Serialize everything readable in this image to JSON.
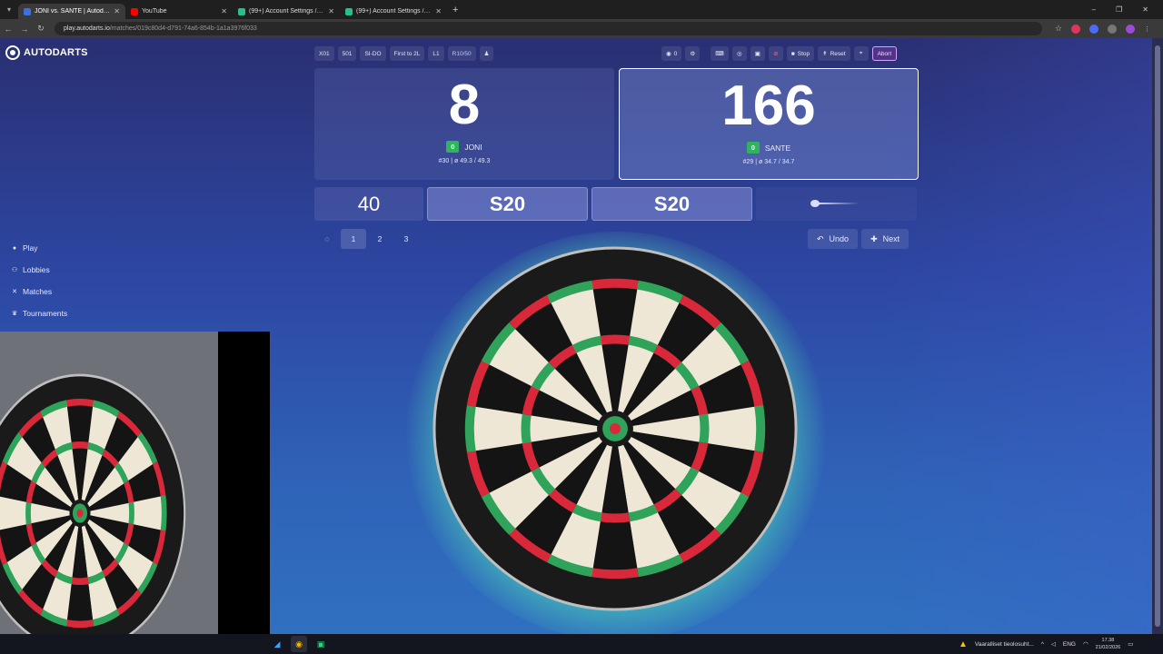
{
  "browser": {
    "tabs": [
      {
        "label": "JONI vs. SANTE | Autodarts Play",
        "favicon_color": "#3d6fe0",
        "active": true
      },
      {
        "label": "YouTube",
        "favicon_color": "#ff0000",
        "active": false
      },
      {
        "label": "(99+) Account Settings / Strea",
        "favicon_color": "#27c08a",
        "active": false
      },
      {
        "label": "(99+) Account Settings / Strea",
        "favicon_color": "#27c08a",
        "active": false
      }
    ],
    "url_host": "play.autodarts.io",
    "url_path": "/matches/019c80d4-d791-74a6-854b-1a1a3976f033"
  },
  "app": {
    "logo_text": "AUTODARTS"
  },
  "sidenav": [
    {
      "label": "Play",
      "icon": "play-icon"
    },
    {
      "label": "Lobbies",
      "icon": "lobbies-icon"
    },
    {
      "label": "Matches",
      "icon": "matches-icon"
    },
    {
      "label": "Tournaments",
      "icon": "trophy-icon"
    }
  ],
  "match_settings": [
    "X01",
    "501",
    "SI-DO",
    "First to 2L",
    "L1",
    "R10/50"
  ],
  "controls": {
    "viewers": "0",
    "stop": "Stop",
    "reset": "Reset",
    "abort": "Abort"
  },
  "players": [
    {
      "score": "8",
      "legs": "0",
      "name": "JONI",
      "stats": "#30 | ø 49.3 / 49.3"
    },
    {
      "score": "166",
      "legs": "0",
      "name": "SANTE",
      "stats": "#29 | ø 34.7 / 34.7"
    }
  ],
  "turn": {
    "remaining": "40",
    "darts": [
      "S20",
      "S20"
    ]
  },
  "rounds": [
    "1",
    "2",
    "3"
  ],
  "actions": {
    "undo": "Undo",
    "next": "Next"
  },
  "taskbar": {
    "notification": "Vaaralliset tieolosuht...",
    "language": "ENG",
    "time": "17.38",
    "date": "21/02/2026"
  }
}
